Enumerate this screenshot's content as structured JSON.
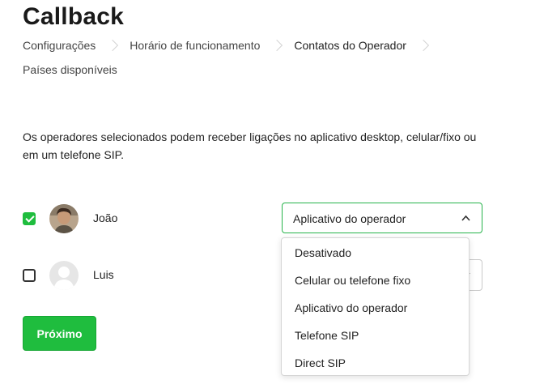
{
  "page": {
    "title": "Callback"
  },
  "tabs": [
    {
      "label": "Configurações"
    },
    {
      "label": "Horário de funcionamento"
    },
    {
      "label": "Contatos do Operador"
    },
    {
      "label": "Países disponíveis"
    }
  ],
  "active_tab": "Contatos do Operador",
  "description": "Os operadores selecionados podem receber ligações no aplicativo desktop, celular/fixo ou em um telefone SIP.",
  "operators": [
    {
      "name": "João",
      "checked": true,
      "contact_type": "Aplicativo do operador"
    },
    {
      "name": "Luis",
      "checked": false,
      "contact_type": ""
    }
  ],
  "dropdown": {
    "options": [
      "Desativado",
      "Celular ou telefone fixo",
      "Aplicativo do operador",
      "Telefone SIP",
      "Direct SIP"
    ]
  },
  "buttons": {
    "next_label": "Próximo"
  },
  "colors": {
    "accent": "#1fbd3e",
    "select_border": "#26b34a"
  }
}
